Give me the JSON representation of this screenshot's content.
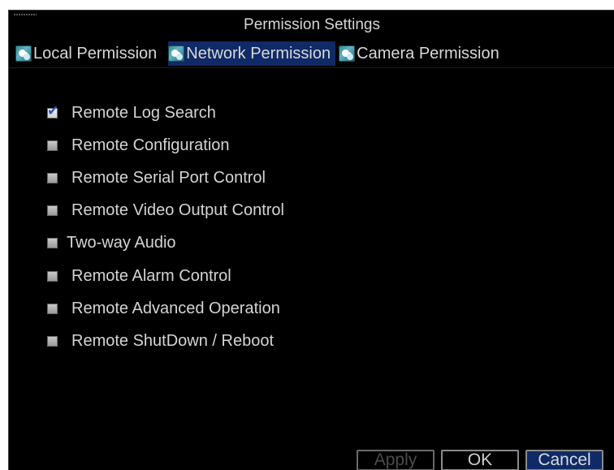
{
  "window": {
    "title": "Permission Settings"
  },
  "tabs": [
    {
      "label": "Local Permission",
      "icon": "people-icon",
      "active": false
    },
    {
      "label": "Network Permission",
      "icon": "people-icon",
      "active": true
    },
    {
      "label": "Camera Permission",
      "icon": "people-icon",
      "active": false
    }
  ],
  "permissions": [
    {
      "label": "Remote Log Search",
      "checked": true
    },
    {
      "label": "Remote Configuration",
      "checked": false
    },
    {
      "label": "Remote Serial Port Control",
      "checked": false
    },
    {
      "label": "Remote Video Output Control",
      "checked": false
    },
    {
      "label": "Two-way Audio",
      "checked": false
    },
    {
      "label": "Remote Alarm Control",
      "checked": false
    },
    {
      "label": "Remote Advanced Operation",
      "checked": false
    },
    {
      "label": "Remote ShutDown / Reboot",
      "checked": false
    }
  ],
  "buttons": {
    "apply": "Apply",
    "ok": "OK",
    "cancel": "Cancel"
  },
  "colors": {
    "background": "#000000",
    "active_tab": "#0f2a66",
    "checkmark": "#2a56c8",
    "text": "#d4d4d4"
  }
}
